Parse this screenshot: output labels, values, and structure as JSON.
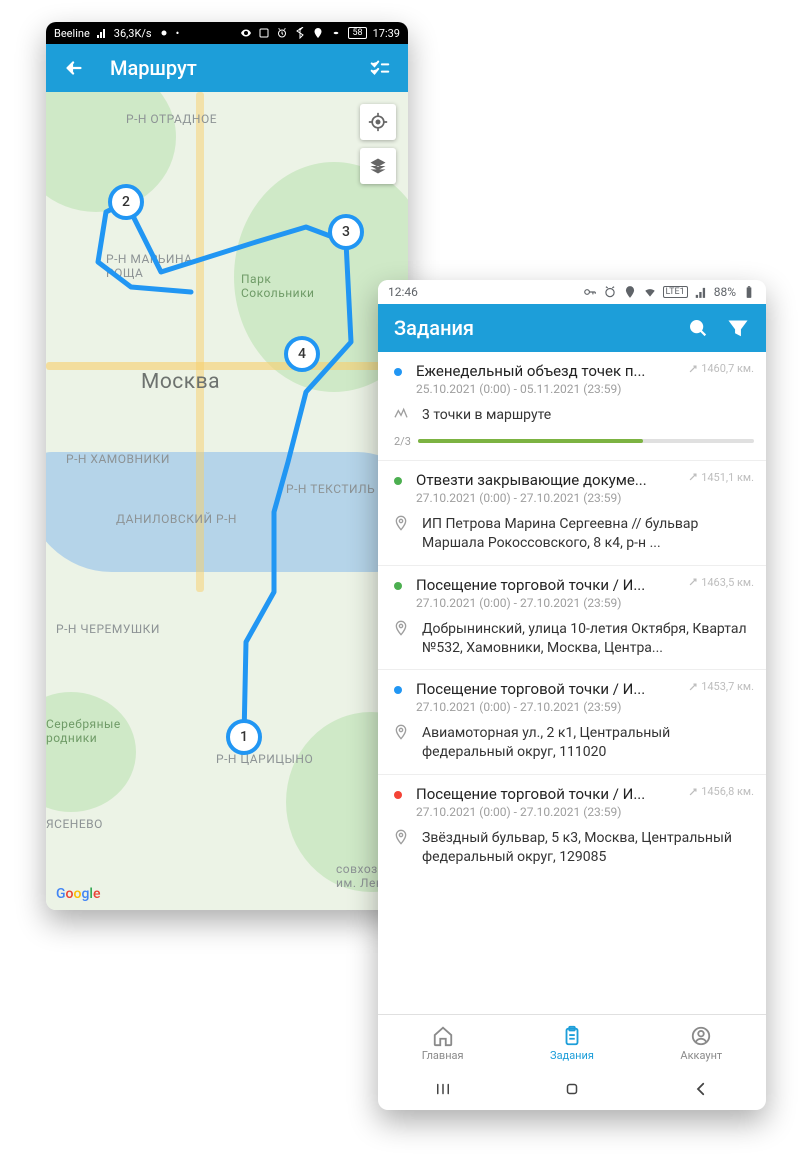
{
  "phoneA": {
    "status": {
      "carrier": "Beeline",
      "netSpeed": "36,3K/s",
      "battery": "58",
      "time": "17:39"
    },
    "appbar": {
      "title": "Маршрут"
    },
    "map": {
      "city": "Москва",
      "parkLabel": "Парк\nСокольники",
      "districts": {
        "otradnoe": "Р-Н ОТРАДНОЕ",
        "marina": "Р-Н МАРЬИНА\nРОЩА",
        "khamovniki": "Р-Н ХАМОВНИКИ",
        "danilovsky": "ДАНИЛОВСКИЙ Р-Н",
        "tekstil": "Р-Н ТЕКСТИЛЬ",
        "cheremushki": "Р-Н ЧЕРЕМУШКИ",
        "yasenevo": "ЯСЕНЕВО",
        "tsaritsyno": "Р-Н ЦАРИЦЫНО",
        "rodniki": "Серебряные\nродники",
        "sovkhoz": "совхоз\nим. Лени"
      },
      "pins": {
        "p1": "1",
        "p2": "2",
        "p3": "3",
        "p4": "4"
      },
      "google": "Google"
    }
  },
  "phoneB": {
    "status": {
      "time": "12:46",
      "battery": "88%"
    },
    "appbar": {
      "title": "Задания"
    },
    "tasks": [
      {
        "color": "blue",
        "title": "Еженедельный объезд точек п...",
        "dates": "25.10.2021 (0:00) - 05.11.2021 (23:59)",
        "km": "1460,7 км.",
        "routeSummary": "3 точки в маршруте",
        "progressLabel": "2/3",
        "progressPct": 67
      },
      {
        "color": "green",
        "title": "Отвезти закрывающие докуме...",
        "dates": "27.10.2021 (0:00) - 27.10.2021 (23:59)",
        "km": "1451,1 км.",
        "address": "ИП Петрова Марина Сергеевна  //  бульвар Маршала Рокоссовского, 8 к4, р-н ..."
      },
      {
        "color": "green",
        "title": "Посещение торговой точки / И...",
        "dates": "27.10.2021 (0:00) - 27.10.2021 (23:59)",
        "km": "1463,5 км.",
        "address": "Добрынинский, улица 10-летия Октября, Квартал №532, Хамовники, Москва, Центра..."
      },
      {
        "color": "blue",
        "title": "Посещение торговой точки / И...",
        "dates": "27.10.2021 (0:00) - 27.10.2021 (23:59)",
        "km": "1453,7 км.",
        "address": "Авиамоторная ул., 2 к1, Центральный федеральный округ, 111020"
      },
      {
        "color": "red",
        "title": "Посещение торговой точки / И...",
        "dates": "27.10.2021 (0:00) - 27.10.2021 (23:59)",
        "km": "1456,8 км.",
        "address": "Звёздный бульвар, 5 к3, Москва, Центральный федеральный округ, 129085"
      }
    ],
    "nav": {
      "home": "Главная",
      "tasks": "Задания",
      "account": "Аккаунт"
    }
  }
}
